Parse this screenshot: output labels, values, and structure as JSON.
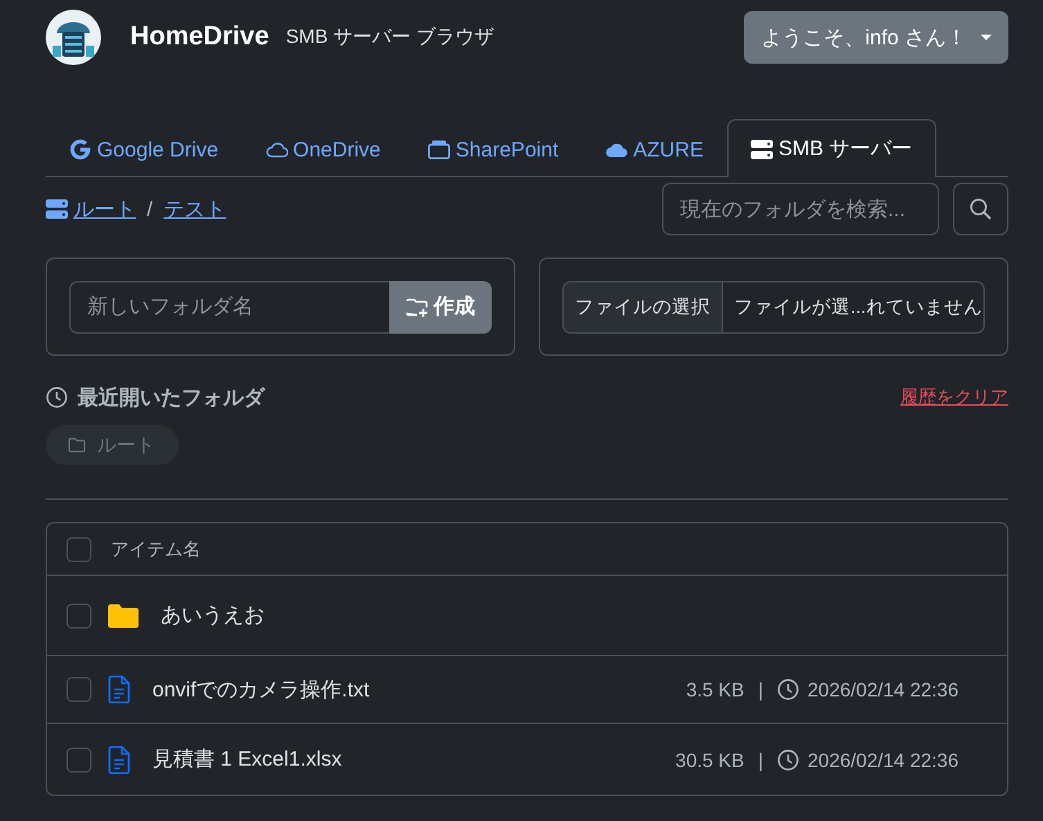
{
  "header": {
    "title": "HomeDrive",
    "subtitle": "SMB サーバー ブラウザ",
    "user_menu": "ようこそ、info さん！"
  },
  "tabs": [
    {
      "kind": "google",
      "label": "Google Drive",
      "selected": false
    },
    {
      "kind": "cloud-outline",
      "label": "OneDrive",
      "selected": false
    },
    {
      "kind": "tray",
      "label": "SharePoint",
      "selected": false
    },
    {
      "kind": "cloud",
      "label": "AZURE",
      "selected": false
    },
    {
      "kind": "server",
      "label": "SMB サーバー",
      "selected": true
    }
  ],
  "breadcrumb": {
    "items": [
      "ルート",
      "テスト"
    ],
    "separator": "/"
  },
  "search": {
    "placeholder": "現在のフォルダを検索..."
  },
  "new_folder": {
    "placeholder": "新しいフォルダ名",
    "button": "作成"
  },
  "upload": {
    "button": "ファイルの選択",
    "status": "ファイルが選...れていません"
  },
  "recent": {
    "title": "最近開いたフォルダ",
    "clear": "履歴をクリア",
    "folders": [
      "ルート"
    ]
  },
  "table": {
    "header": "アイテム名",
    "header_checked": false,
    "separator": "|",
    "rows": [
      {
        "kind": "folder",
        "name": "あいうえお",
        "checked": false
      },
      {
        "kind": "file",
        "name": "onvifでのカメラ操作.txt",
        "size": "3.5 KB",
        "modified": "2026/02/14 22:36",
        "checked": false
      },
      {
        "kind": "file",
        "name": "見積書 1 Excel1.xlsx",
        "size": "30.5 KB",
        "modified": "2026/02/14 22:36",
        "checked": false
      }
    ]
  }
}
